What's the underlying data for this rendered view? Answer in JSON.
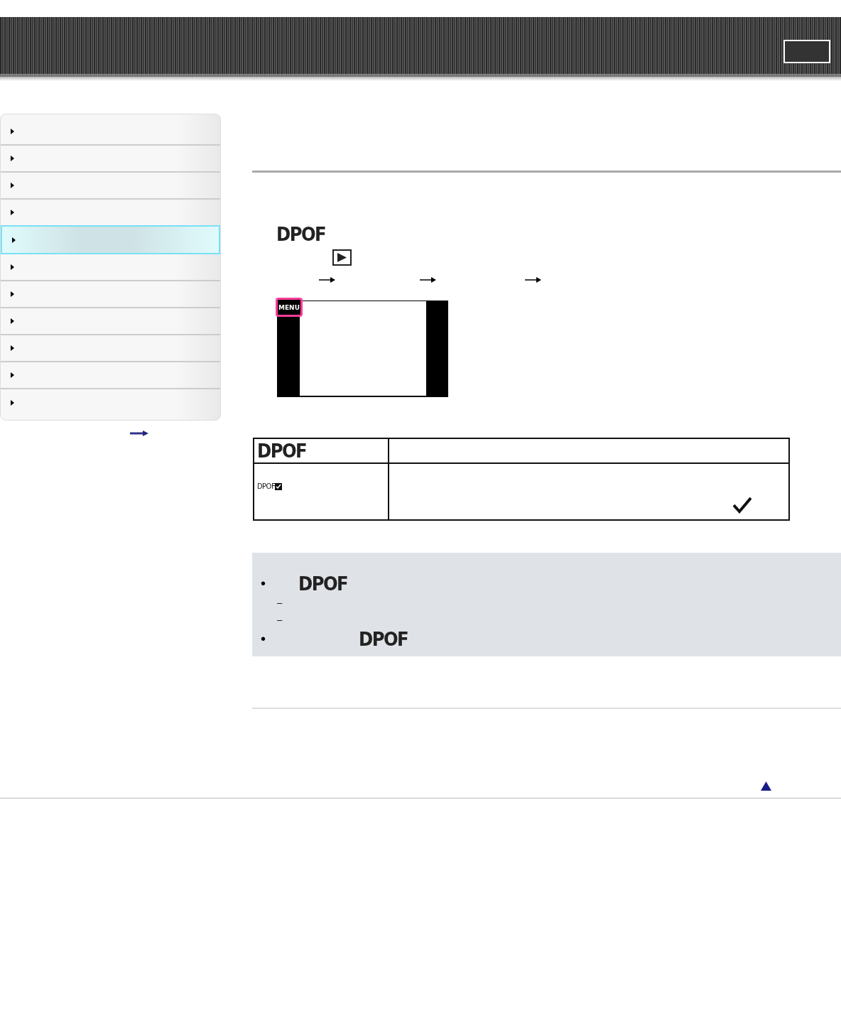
{
  "sidebar": {
    "items": [
      {
        "selected": false
      },
      {
        "selected": false
      },
      {
        "selected": false
      },
      {
        "selected": false
      },
      {
        "selected": true
      },
      {
        "selected": false
      },
      {
        "selected": false
      },
      {
        "selected": false
      },
      {
        "selected": false
      },
      {
        "selected": false
      },
      {
        "selected": false
      }
    ]
  },
  "content": {
    "mode_label": "DPOF",
    "screen": {
      "menu_label": "MENU"
    },
    "table": {
      "rows": [
        {
          "kind": "large",
          "label": "DPOF"
        },
        {
          "kind": "small",
          "label": "DPOF"
        }
      ]
    },
    "notes": [
      {
        "kind": "bullet",
        "marker": "•",
        "label": "DPOF"
      },
      {
        "kind": "dash",
        "marker": "–"
      },
      {
        "kind": "dash",
        "marker": "–"
      },
      {
        "kind": "bullet-far",
        "marker": "•",
        "label": "DPOF"
      }
    ]
  }
}
